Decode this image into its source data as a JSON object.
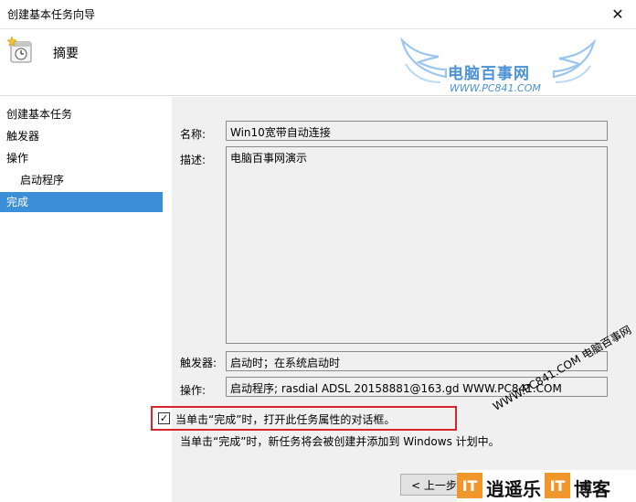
{
  "window": {
    "title": "创建基本任务向导",
    "close_glyph": "✕"
  },
  "header": {
    "heading": "摘要",
    "icon": "scheduled-task-icon"
  },
  "logo": {
    "name": "电脑百事网",
    "url": "WWW.PC841.COM"
  },
  "sidebar": {
    "items": [
      {
        "label": "创建基本任务"
      },
      {
        "label": "触发器"
      },
      {
        "label": "操作"
      },
      {
        "label": "启动程序"
      },
      {
        "label": "完成"
      }
    ]
  },
  "form": {
    "name_label": "名称:",
    "name_value": "Win10宽带自动连接",
    "description_label": "描述:",
    "description_value": "电脑百事网演示",
    "trigger_label": "触发器:",
    "trigger_value": "启动时；在系统启动时",
    "action_label": "操作:",
    "action_value": "启动程序; rasdial ADSL 20158881@163.gd WWW.PC841.COM",
    "open_properties_label": "当单击“完成”时，打开此任务属性的对话框。",
    "open_properties_checked": true,
    "finish_note": "当单击“完成”时，新任务将会被创建并添加到 Windows 计划中。"
  },
  "buttons": {
    "back_label": "< 上一步"
  },
  "watermark": {
    "diagonal": "WWW.PC841.COM 电脑百事网",
    "brand": "逍遥乐",
    "brand_it": "IT",
    "brand_tail": "博客"
  },
  "colors": {
    "accent": "#3d8ed8",
    "highlight_border": "#d9262a",
    "logo_blue": "#4c92d6",
    "brand_orange": "#f0962b"
  }
}
